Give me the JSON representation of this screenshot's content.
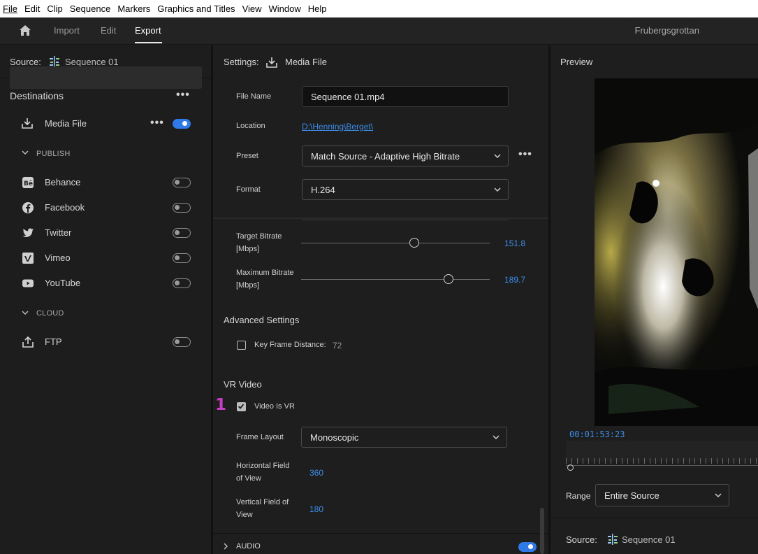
{
  "menu": [
    "File",
    "Edit",
    "Clip",
    "Sequence",
    "Markers",
    "Graphics and Titles",
    "View",
    "Window",
    "Help"
  ],
  "topbar": {
    "tabs": [
      "Import",
      "Edit",
      "Export"
    ],
    "active_tab": "Export",
    "project_name": "Frubergsgrottan"
  },
  "left": {
    "source_label": "Source:",
    "source_name": "Sequence 01",
    "destinations_title": "Destinations",
    "media_file": "Media File",
    "publish_header": "PUBLISH",
    "publish_items": [
      "Behance",
      "Facebook",
      "Twitter",
      "Vimeo",
      "YouTube"
    ],
    "cloud_header": "CLOUD",
    "cloud_items": [
      "FTP"
    ]
  },
  "settings": {
    "title": "Settings:",
    "title_value": "Media File",
    "file_name_label": "File Name",
    "file_name": "Sequence 01.mp4",
    "location_label": "Location",
    "location": "D:\\Henning\\Berget\\",
    "preset_label": "Preset",
    "preset": "Match Source - Adaptive High Bitrate",
    "format_label": "Format",
    "format": "H.264",
    "target_bitrate_label_1": "Target Bitrate",
    "target_bitrate_label_2": "[Mbps]",
    "target_bitrate": "151.8",
    "target_bitrate_fraction": 0.6,
    "max_bitrate_label_1": "Maximum Bitrate",
    "max_bitrate_label_2": "[Mbps]",
    "max_bitrate": "189.7",
    "max_bitrate_fraction": 0.78,
    "advanced_title": "Advanced Settings",
    "key_frame_label": "Key Frame Distance:",
    "key_frame_value": "72",
    "vr_title": "VR Video",
    "video_is_vr_label": "Video Is VR",
    "marker": "1",
    "frame_layout_label": "Frame Layout",
    "frame_layout": "Monoscopic",
    "hfov_label_1": "Horizontal Field",
    "hfov_label_2": "of View",
    "hfov": "360",
    "vfov_label_1": "Vertical Field of",
    "vfov_label_2": "View",
    "vfov": "180",
    "audio_label": "AUDIO"
  },
  "preview": {
    "title": "Preview",
    "timecode": "00:01:53:23",
    "range_label": "Range",
    "range_value": "Entire Source",
    "source_label": "Source:",
    "source_name": "Sequence 01"
  },
  "colors": {
    "accent": "#2f7ae8",
    "link": "#3b8eea",
    "marker": "#c63ec6"
  }
}
